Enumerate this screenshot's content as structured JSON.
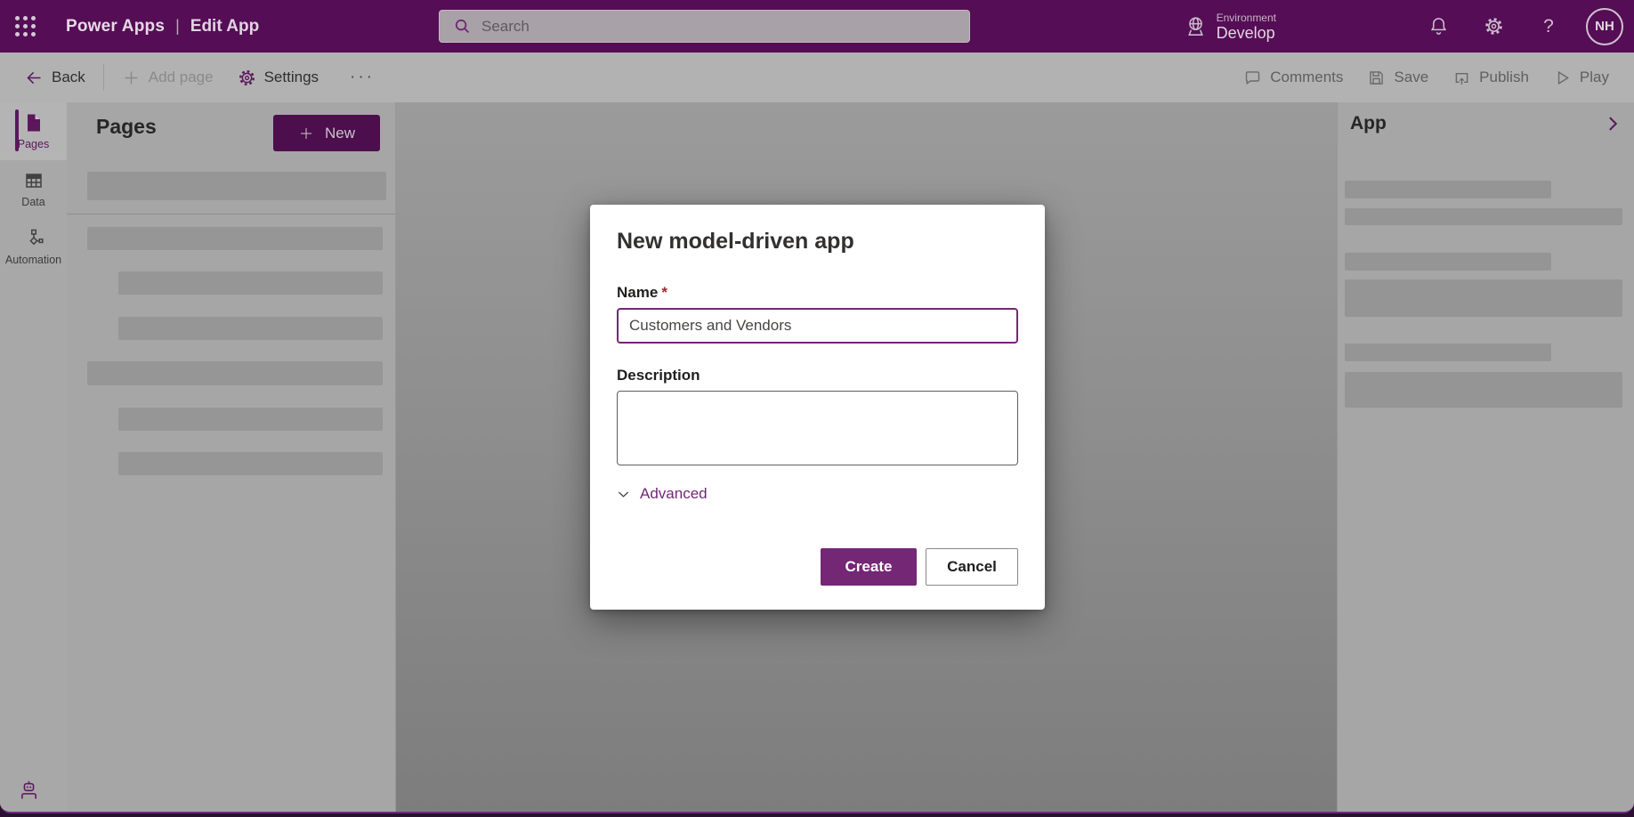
{
  "topbar": {
    "app_name": "Power Apps",
    "separator": "|",
    "page_name": "Edit App",
    "search_placeholder": "Search",
    "environment_label": "Environment",
    "environment_name": "Develop",
    "help_glyph": "?",
    "avatar_initials": "NH"
  },
  "toolbar": {
    "back_label": "Back",
    "add_page_label": "Add page",
    "settings_label": "Settings",
    "overflow_glyph": "···",
    "comments_label": "Comments",
    "save_label": "Save",
    "publish_label": "Publish",
    "play_label": "Play"
  },
  "rail": {
    "pages_label": "Pages",
    "data_label": "Data",
    "automation_label": "Automation"
  },
  "pages_panel": {
    "title": "Pages",
    "new_button_label": "New"
  },
  "app_panel": {
    "title": "App"
  },
  "dialog": {
    "title": "New model-driven app",
    "name_label": "Name",
    "required_marker": "*",
    "name_value": "Customers and Vendors",
    "description_label": "Description",
    "advanced_label": "Advanced",
    "create_label": "Create",
    "cancel_label": "Cancel"
  },
  "colors": {
    "brand_purple": "#742774",
    "header_background": "#550d55",
    "required_red": "#a4262c"
  }
}
